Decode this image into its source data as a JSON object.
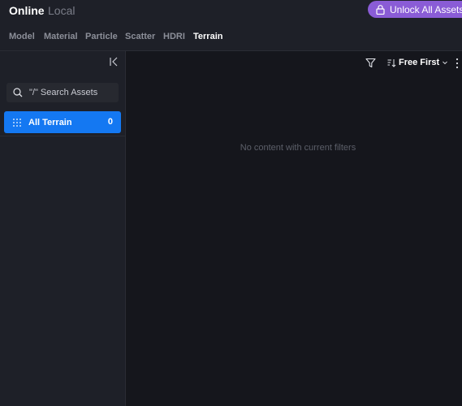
{
  "scope_tabs": [
    {
      "label": "Online",
      "active": true
    },
    {
      "label": "Local",
      "active": false
    }
  ],
  "unlock_button": {
    "label": "Unlock All Assets",
    "icon": "lock-icon",
    "color": "#8a5cd6"
  },
  "category_tabs": [
    {
      "label": "Model"
    },
    {
      "label": "Material"
    },
    {
      "label": "Particle"
    },
    {
      "label": "Scatter"
    },
    {
      "label": "HDRI"
    },
    {
      "label": "Terrain",
      "active": true
    }
  ],
  "sidebar": {
    "search": {
      "placeholder": "\"/\" Search Assets"
    },
    "items": [
      {
        "label": "All Terrain",
        "count": "0",
        "active": true
      }
    ]
  },
  "toolbar": {
    "sort_label": "Free First"
  },
  "main": {
    "empty_message": "No content with current filters"
  },
  "colors": {
    "accent": "#1478f2",
    "background": "#15161c",
    "panel": "#1e2028"
  }
}
